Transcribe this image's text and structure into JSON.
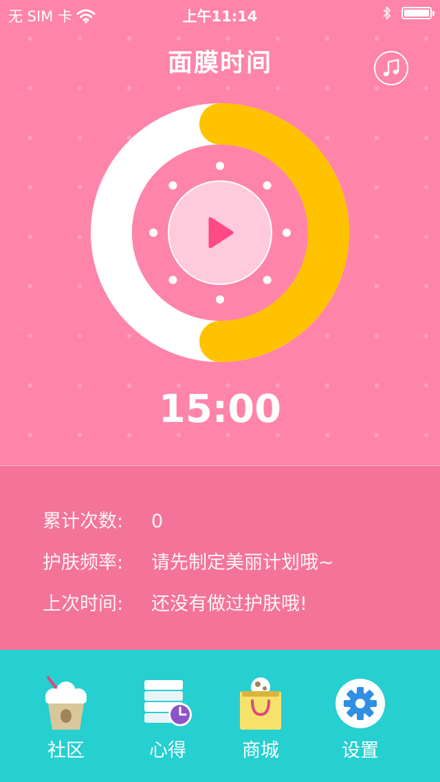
{
  "status_bar": {
    "carrier": "无 SIM 卡",
    "time": "上午11:14"
  },
  "header": {
    "title": "面膜时间",
    "music_icon": "music-note-icon"
  },
  "timer": {
    "display": "15:00",
    "progress": 0.5,
    "ring_color": "#ffc200",
    "track_color": "#ffffff",
    "play_icon": "play-icon"
  },
  "info": {
    "rows": [
      {
        "label": "累计次数:",
        "value": "0"
      },
      {
        "label": "护肤频率:",
        "value": "请先制定美丽计划哦~"
      },
      {
        "label": "上次时间:",
        "value": "还没有做过护肤哦!"
      }
    ]
  },
  "tabs": [
    {
      "label": "社区",
      "icon": "ice-cream-cup-icon"
    },
    {
      "label": "心得",
      "icon": "notes-clock-icon"
    },
    {
      "label": "商城",
      "icon": "shopping-bag-icon"
    },
    {
      "label": "设置",
      "icon": "gear-icon"
    }
  ],
  "colors": {
    "primary_pink": "#ff84aa",
    "panel_pink": "#f47399",
    "tab_teal": "#26cfd0",
    "accent_yellow": "#ffc200"
  }
}
